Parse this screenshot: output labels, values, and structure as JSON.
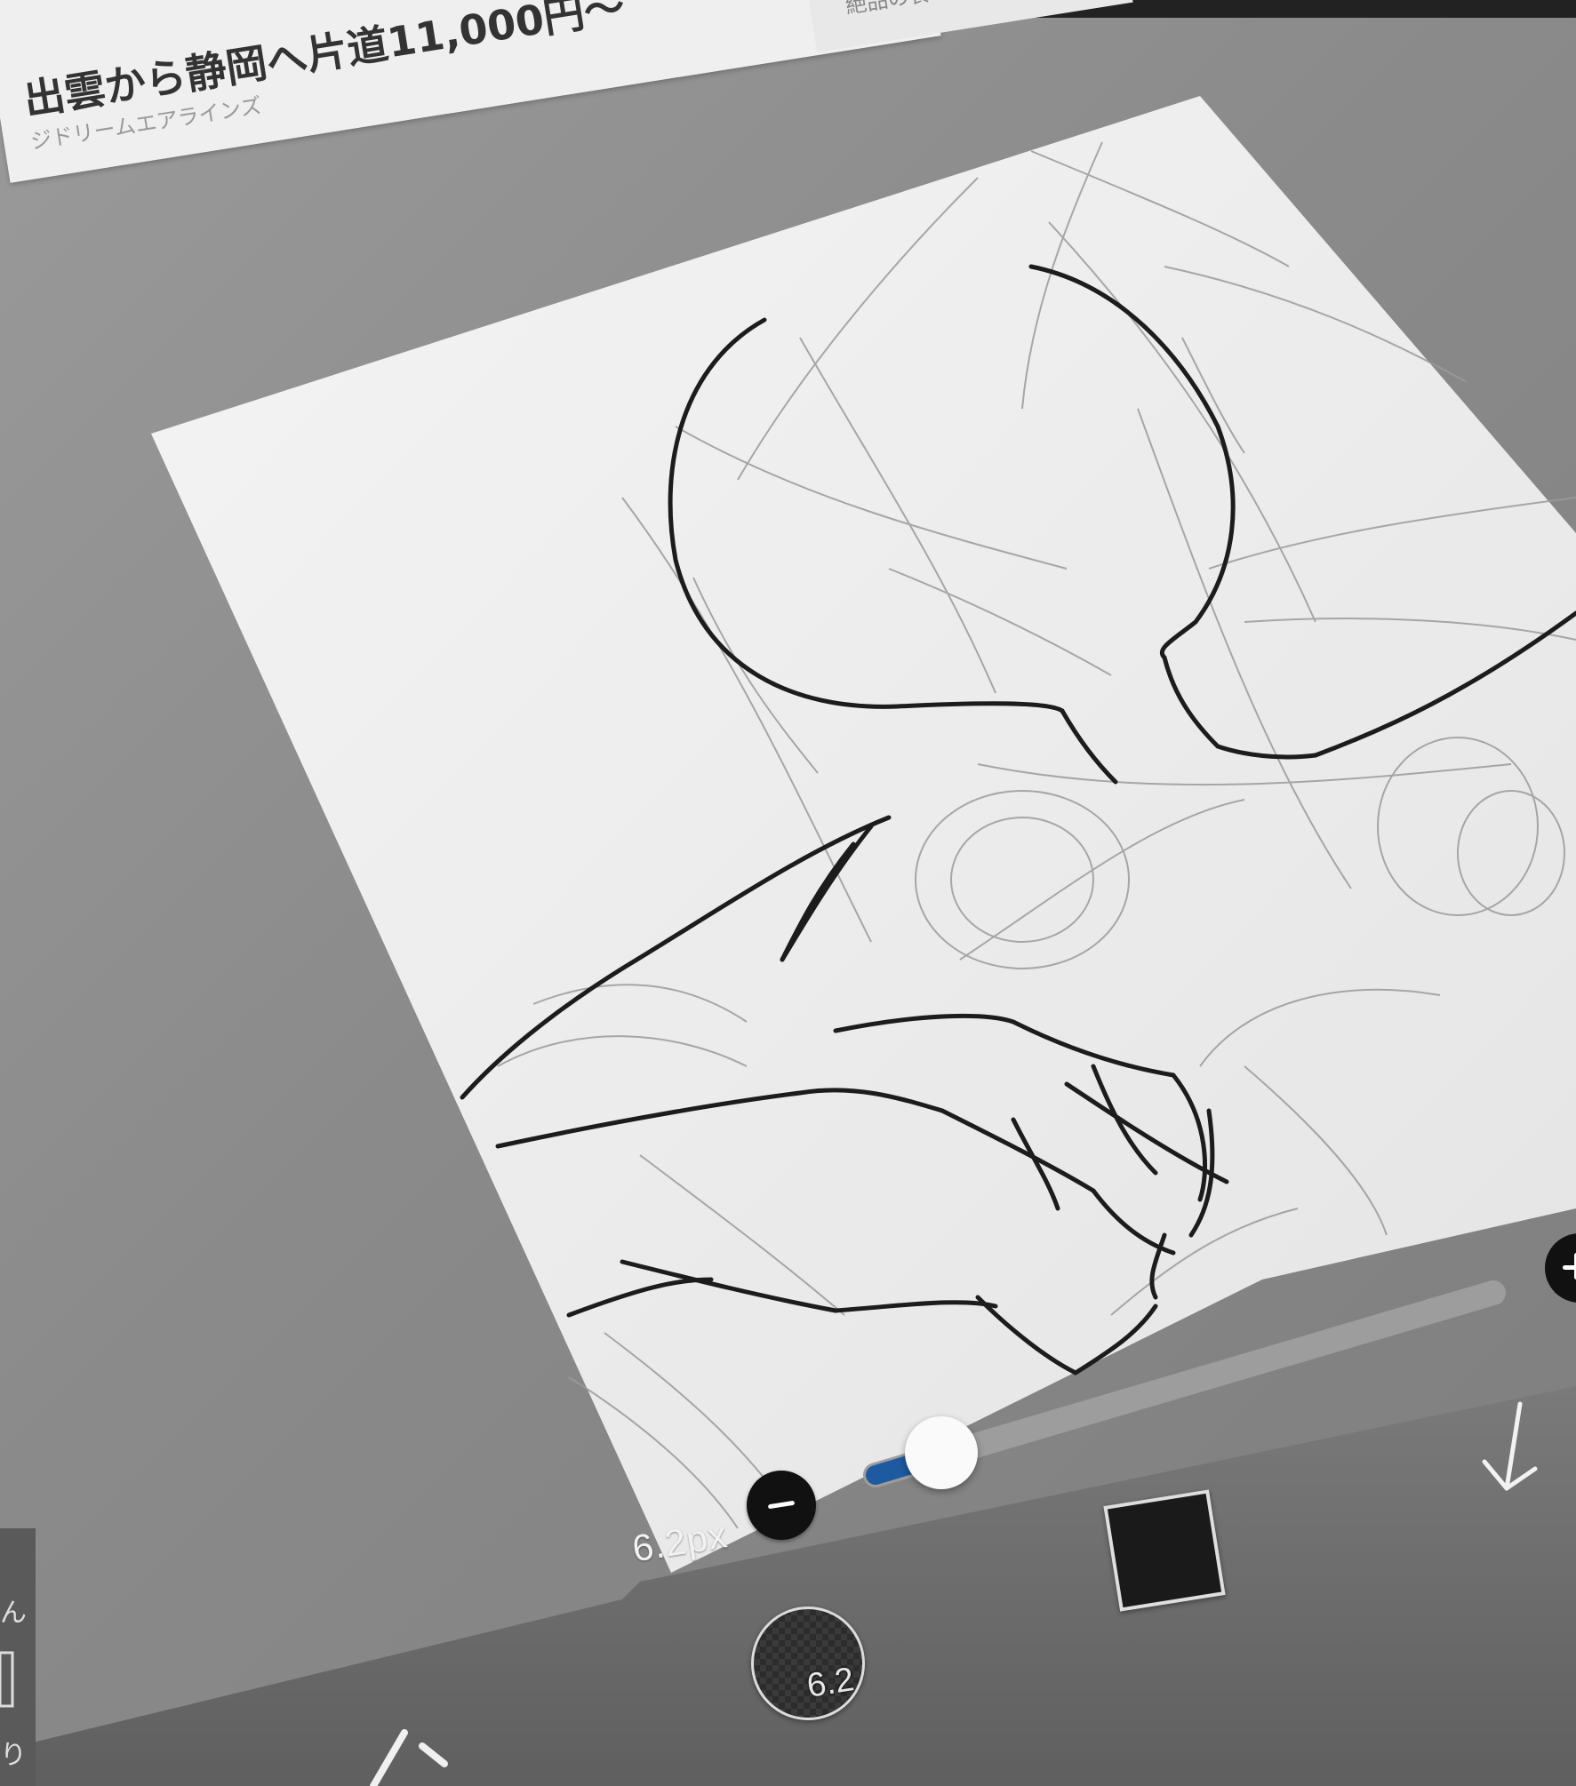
{
  "ad": {
    "title": "出雲から静岡へ片道11,000円～",
    "subtitle": "ジドリームエアラインズ",
    "side_text": "絶品の食を楽しむ"
  },
  "brush": {
    "size_label": "6.2px",
    "preview_value": "6.2",
    "size_slider_level": 0.05
  },
  "color": {
    "current": "#1a1a1a"
  },
  "left_strip": {
    "glyph_top": "ん",
    "glyph_bottom": "り"
  },
  "icons": {
    "minus": "minus-icon",
    "plus": "plus-icon",
    "download": "down-arrow-icon",
    "pen": "pen-tool-icon"
  },
  "colors": {
    "paper": "#f0f0f0",
    "toolbar": "#6b6b6b",
    "accent": "#1e5aa0"
  }
}
